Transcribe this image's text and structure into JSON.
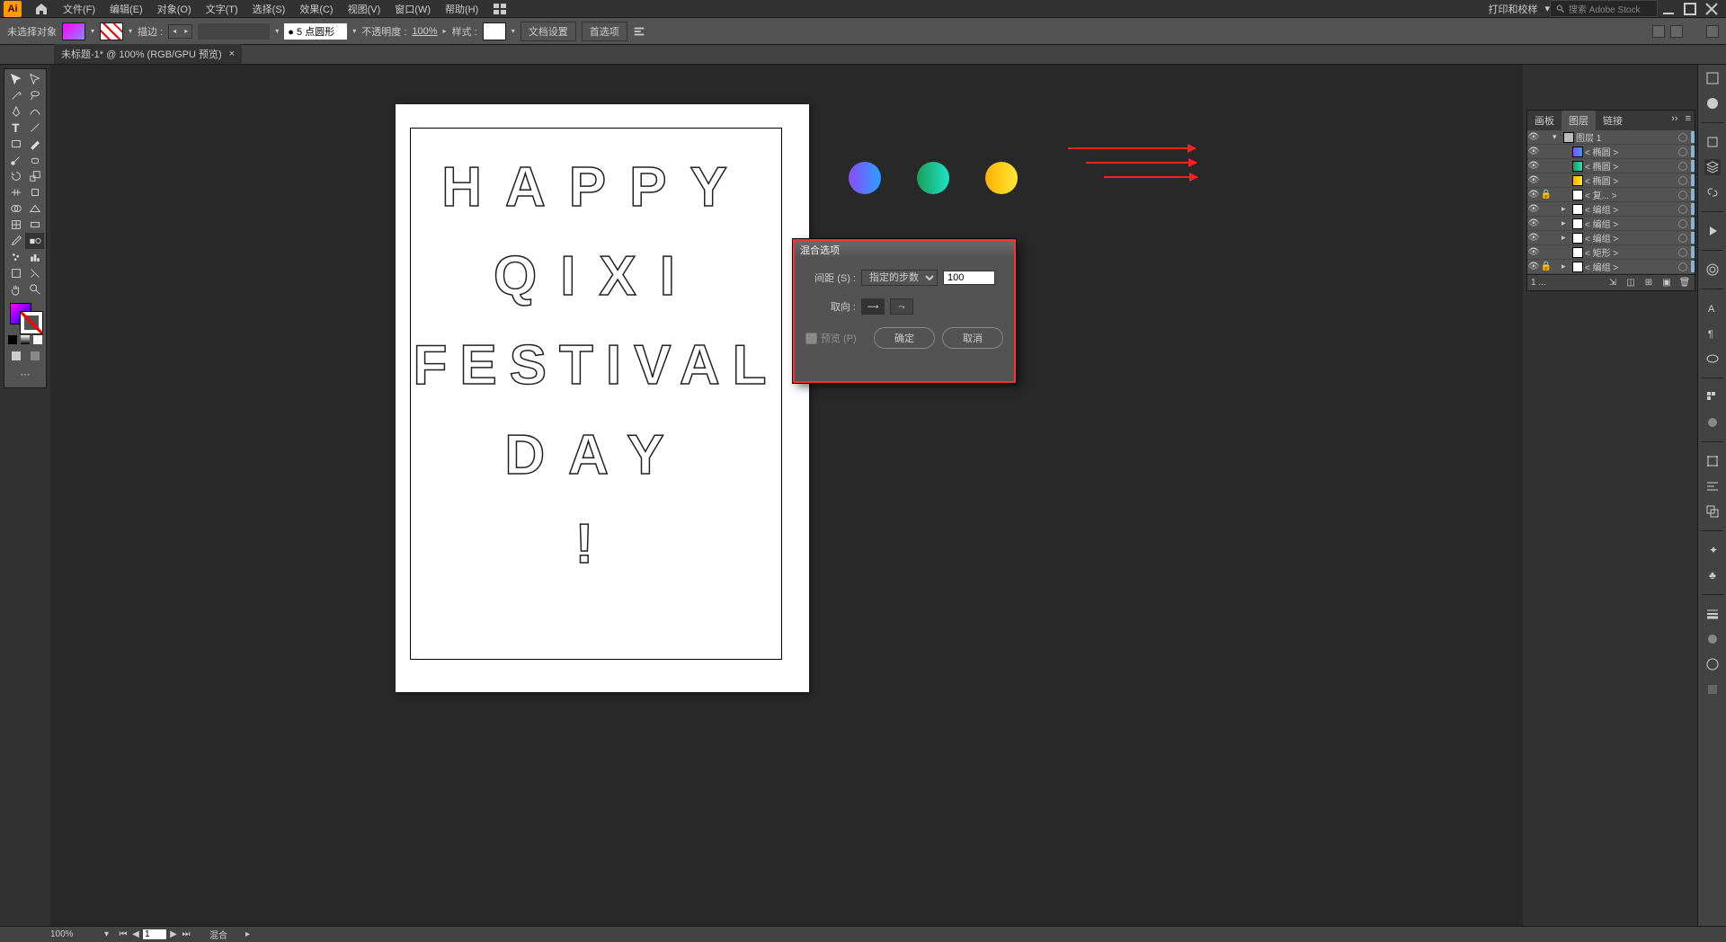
{
  "menubar": {
    "logo": "Ai",
    "items": [
      "文件(F)",
      "编辑(E)",
      "对象(O)",
      "文字(T)",
      "选择(S)",
      "效果(C)",
      "视图(V)",
      "窗口(W)",
      "帮助(H)"
    ],
    "right_label": "打印和校样",
    "search_placeholder": "搜索 Adobe Stock"
  },
  "controlbar": {
    "selection_label": "未选择对象",
    "stroke_label": "描边 :",
    "stroke_weight": "5 点圆形",
    "opacity_label": "不透明度 :",
    "opacity_value": "100%",
    "style_label": "样式 :",
    "doc_setup": "文档设置",
    "preferences": "首选项"
  },
  "tab": {
    "title": "未标题-1* @ 100% (RGB/GPU 预览)"
  },
  "artboard": {
    "lines": [
      "HAPPY",
      "QIXI",
      "FESTIVAL",
      "DAY",
      "!"
    ]
  },
  "dialog": {
    "title": "混合选项",
    "spacing_label": "间距 (S) :",
    "spacing_option": "指定的步数",
    "spacing_value": "100",
    "orientation_label": "取向 :",
    "preview_label": "预览 (P)",
    "ok": "确定",
    "cancel": "取消"
  },
  "layers": {
    "tabs": [
      "画板",
      "图层",
      "链接"
    ],
    "top_name": "图层 1",
    "items": [
      {
        "name": "< 椭圆 >",
        "color": "grad1",
        "lock": false
      },
      {
        "name": "< 椭圆 >",
        "color": "grad2",
        "lock": false
      },
      {
        "name": "< 椭圆 >",
        "color": "grad3",
        "lock": false
      },
      {
        "name": "< 复... >",
        "color": "plain",
        "lock": true
      },
      {
        "name": "< 编组 >",
        "color": "plain",
        "lock": false,
        "exp": true
      },
      {
        "name": "< 编组 >",
        "color": "plain",
        "lock": false,
        "exp": true
      },
      {
        "name": "< 编组 >",
        "color": "plain",
        "lock": false,
        "exp": true
      },
      {
        "name": "< 矩形 >",
        "color": "plain",
        "lock": false
      },
      {
        "name": "< 编组 >",
        "color": "plain",
        "lock": true,
        "exp": true
      }
    ],
    "footer_label": "1 ..."
  },
  "statusbar": {
    "zoom": "100%",
    "page": "1",
    "mode": "混合"
  }
}
